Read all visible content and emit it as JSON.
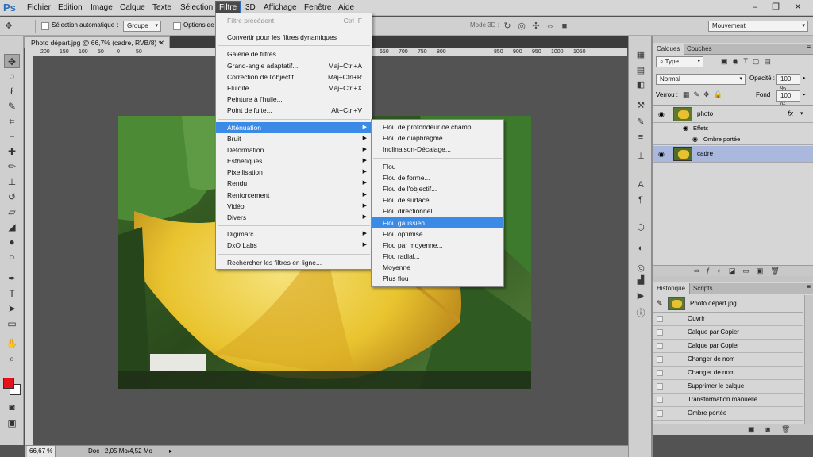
{
  "app": {
    "logo": "Ps"
  },
  "menubar": {
    "items": [
      "Fichier",
      "Edition",
      "Image",
      "Calque",
      "Texte",
      "Sélection",
      "Filtre",
      "3D",
      "Affichage",
      "Fenêtre",
      "Aide"
    ],
    "active": "Filtre"
  },
  "window": {
    "minimize": "–",
    "restore": "❐",
    "close": "✕"
  },
  "options": {
    "auto_select_label": "Sélection automatique :",
    "auto_select_value": "Groupe",
    "transform_label": "Options de t",
    "mode3d_label": "Mode 3D :",
    "workspace": "Mouvement"
  },
  "document": {
    "tab_title": "Photo départ.jpg @ 66,7% (cadre, RVB/8) *",
    "zoom": "66,67 %",
    "doc_info": "Doc : 2,05 Mo/4,52 Mo"
  },
  "ruler": {
    "ticks": [
      "200",
      "150",
      "100",
      "50",
      "0",
      "50",
      "650",
      "700",
      "750",
      "800",
      "850",
      "900",
      "950",
      "1000",
      "1050"
    ]
  },
  "filter_menu": {
    "items": [
      {
        "label": "Filtre précédent",
        "shortcut": "Ctrl+F",
        "disabled": true
      },
      {
        "sep": true
      },
      {
        "label": "Convertir pour les filtres dynamiques"
      },
      {
        "sep": true
      },
      {
        "label": "Galerie de filtres..."
      },
      {
        "label": "Grand-angle adaptatif...",
        "shortcut": "Maj+Ctrl+A"
      },
      {
        "label": "Correction de l'objectif...",
        "shortcut": "Maj+Ctrl+R"
      },
      {
        "label": "Fluidité...",
        "shortcut": "Maj+Ctrl+X"
      },
      {
        "label": "Peinture à l'huile..."
      },
      {
        "label": "Point de fuite...",
        "shortcut": "Alt+Ctrl+V"
      },
      {
        "sep": true
      },
      {
        "label": "Atténuation",
        "submenu": true,
        "highlighted": true
      },
      {
        "label": "Bruit",
        "submenu": true
      },
      {
        "label": "Déformation",
        "submenu": true
      },
      {
        "label": "Esthétiques",
        "submenu": true
      },
      {
        "label": "Pixellisation",
        "submenu": true
      },
      {
        "label": "Rendu",
        "submenu": true
      },
      {
        "label": "Renforcement",
        "submenu": true
      },
      {
        "label": "Vidéo",
        "submenu": true
      },
      {
        "label": "Divers",
        "submenu": true
      },
      {
        "sep": true
      },
      {
        "label": "Digimarc",
        "submenu": true
      },
      {
        "label": "DxO Labs",
        "submenu": true
      },
      {
        "sep": true
      },
      {
        "label": "Rechercher les filtres en ligne..."
      }
    ]
  },
  "blur_submenu": {
    "items": [
      {
        "label": "Flou de profondeur de champ..."
      },
      {
        "label": "Flou de diaphragme..."
      },
      {
        "label": "Inclinaison-Décalage..."
      },
      {
        "sep": true
      },
      {
        "label": "Flou"
      },
      {
        "label": "Flou de forme..."
      },
      {
        "label": "Flou de l'objectif..."
      },
      {
        "label": "Flou de surface..."
      },
      {
        "label": "Flou directionnel..."
      },
      {
        "label": "Flou gaussien...",
        "highlighted": true
      },
      {
        "label": "Flou optimisé..."
      },
      {
        "label": "Flou par moyenne..."
      },
      {
        "label": "Flou radial..."
      },
      {
        "label": "Moyenne"
      },
      {
        "label": "Plus flou"
      }
    ]
  },
  "layers_panel": {
    "tabs": [
      "Calques",
      "Couches"
    ],
    "filter_kind": "Type",
    "blend_mode": "Normal",
    "opacity_label": "Opacité :",
    "opacity": "100 %",
    "lock_label": "Verrou :",
    "fill_label": "Fond :",
    "fill": "100 %",
    "layers": [
      {
        "name": "photo",
        "fx": "fx"
      },
      {
        "name": "Effets"
      },
      {
        "name": "Ombre portée"
      },
      {
        "name": "cadre",
        "selected": true
      }
    ]
  },
  "history_panel": {
    "tabs": [
      "Historique",
      "Scripts"
    ],
    "snapshot": "Photo départ.jpg",
    "items": [
      "Ouvrir",
      "Calque par Copier",
      "Calque par Copier",
      "Changer de nom",
      "Changer de nom",
      "Supprimer le calque",
      "Transformation manuelle",
      "Ombre portée"
    ]
  },
  "colors": {
    "foreground": "#e3121b",
    "background": "#ffffff",
    "menu_highlight": "#3b8ae6",
    "selected_layer": "#a9b8dc"
  }
}
